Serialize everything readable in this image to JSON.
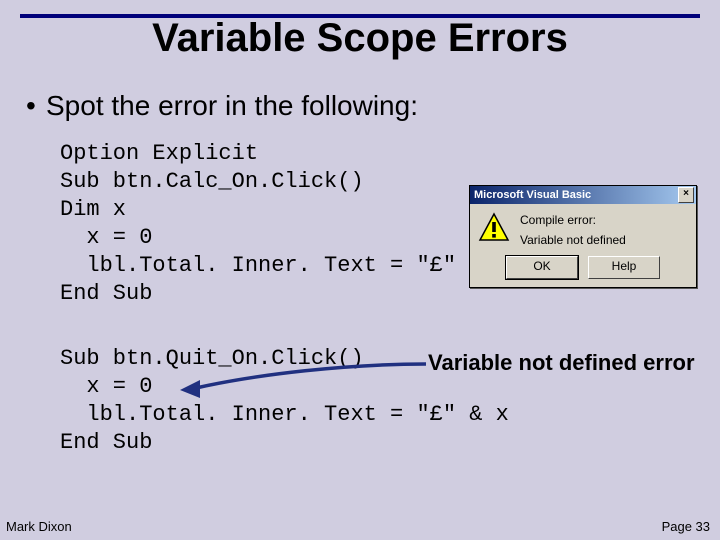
{
  "title": "Variable Scope Errors",
  "bullet": "Spot the error in the following:",
  "code_block_1": "Option Explicit\nSub btn.Calc_On.Click()\nDim x\n  x = 0\n  lbl.Total. Inner. Text = \"£\" & x\nEnd Sub",
  "code_block_2": "Sub btn.Quit_On.Click()\n  x = 0\n  lbl.Total. Inner. Text = \"£\" & x\nEnd Sub",
  "annotation": "Variable not defined\n error",
  "dialog": {
    "title": "Microsoft Visual Basic",
    "line1": "Compile error:",
    "line2": "Variable not defined",
    "ok": "OK",
    "help": "Help",
    "close": "×"
  },
  "footer": {
    "author": "Mark Dixon",
    "page": "Page 33"
  }
}
